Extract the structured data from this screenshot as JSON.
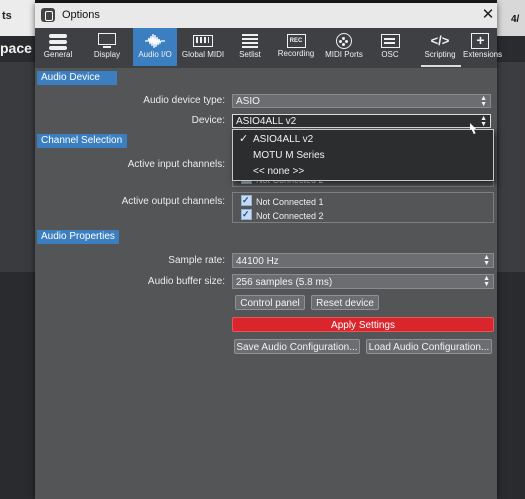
{
  "background": {
    "left_label": "ts",
    "left_title": "pace :",
    "right_label": "4/"
  },
  "window": {
    "title": "Options",
    "close": "✕"
  },
  "toolbar": {
    "items": [
      {
        "label": "General",
        "icon": "general-icon"
      },
      {
        "label": "Display",
        "icon": "display-icon"
      },
      {
        "label": "Audio I/O",
        "icon": "audio-waveform-icon",
        "active": true
      },
      {
        "label": "Global MIDI",
        "icon": "midi-keyboard-icon"
      },
      {
        "label": "Setlist",
        "icon": "list-icon"
      },
      {
        "label": "Recording",
        "icon": "record-icon",
        "badge": "REC"
      },
      {
        "label": "MIDI Ports",
        "icon": "midi-port-icon"
      },
      {
        "label": "OSC",
        "icon": "osc-icon"
      },
      {
        "label": "Scripting",
        "icon": "code-icon",
        "glyph": "</>"
      },
      {
        "label": "Extensions",
        "icon": "plus-box-icon"
      }
    ]
  },
  "audio_device": {
    "header": "Audio Device",
    "type_label": "Audio device type:",
    "type_value": "ASIO",
    "device_label": "Device:",
    "device_value": "ASIO4ALL v2"
  },
  "device_dropdown": {
    "check": "✓",
    "options": [
      "ASIO4ALL v2",
      "MOTU M Series",
      "<< none >>"
    ],
    "selected": "ASIO4ALL v2"
  },
  "channel_selection": {
    "header": "Channel Selection",
    "input_label": "Active input channels:",
    "input_channels": [
      "Not Connected 2"
    ],
    "output_label": "Active output channels:",
    "output_channels": [
      "Not Connected 1",
      "Not Connected 2"
    ]
  },
  "audio_properties": {
    "header": "Audio Properties",
    "sample_rate_label": "Sample rate:",
    "sample_rate_value": "44100 Hz",
    "buffer_label": "Audio buffer size:",
    "buffer_value": "256 samples (5.8 ms)",
    "control_panel": "Control panel",
    "reset_device": "Reset device",
    "apply": "Apply Settings",
    "save_config": "Save Audio Configuration...",
    "load_config": "Load Audio Configuration..."
  },
  "colors": {
    "accent": "#3c7fc0",
    "apply": "#d9262c",
    "panel": "#545557"
  }
}
